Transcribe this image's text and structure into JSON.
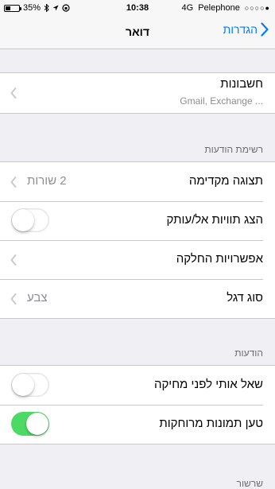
{
  "status_bar": {
    "battery": "35%",
    "time": "10:38",
    "network": "4G",
    "carrier": "Pelephone",
    "signal": "○○○○●"
  },
  "nav": {
    "title": "דואר",
    "back_label": "הגדרות"
  },
  "accounts": {
    "label": "חשבונות",
    "subtitle": "Gmail, Exchange ..."
  },
  "message_list": {
    "header": "רשימת הודעות",
    "rows": [
      {
        "label": "תצוגה מקדימה",
        "value": "2 שורות"
      },
      {
        "label": "הצג תוויות אל/עותק"
      },
      {
        "label": "אפשרויות החלקה"
      },
      {
        "label": "סוג דגל",
        "value": "צבע"
      }
    ]
  },
  "messages": {
    "header": "הודעות",
    "rows": [
      {
        "label": "שאל אותי לפני מחיקה"
      },
      {
        "label": "טען תמונות מרוחקות"
      }
    ]
  },
  "threading": {
    "header": "שרשור"
  },
  "colors": {
    "accent": "#007aff",
    "toggle_on": "#4cd964",
    "background": "#efeff4"
  },
  "toggles": {
    "show_to_cc": false,
    "ask_before_delete": false,
    "load_remote_images": true
  }
}
